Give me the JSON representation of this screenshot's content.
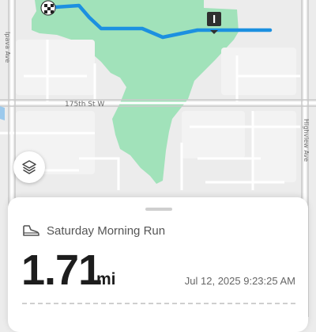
{
  "map": {
    "streets": [
      "175th St W",
      "Ipava Ave",
      "Highview Ave"
    ],
    "start_marker_icon": "checkered-flag-icon",
    "finish_marker_icon": "finish-flag-icon",
    "route_color": "#1c90e0",
    "park_color": "#9ee0b6"
  },
  "layers_button": {
    "icon": "layers-icon"
  },
  "activity": {
    "icon": "shoe-icon",
    "title": "Saturday Morning Run",
    "distance": "1.71",
    "unit": "mi",
    "datetime": "Jul 12, 2025 9:23:25 AM"
  }
}
